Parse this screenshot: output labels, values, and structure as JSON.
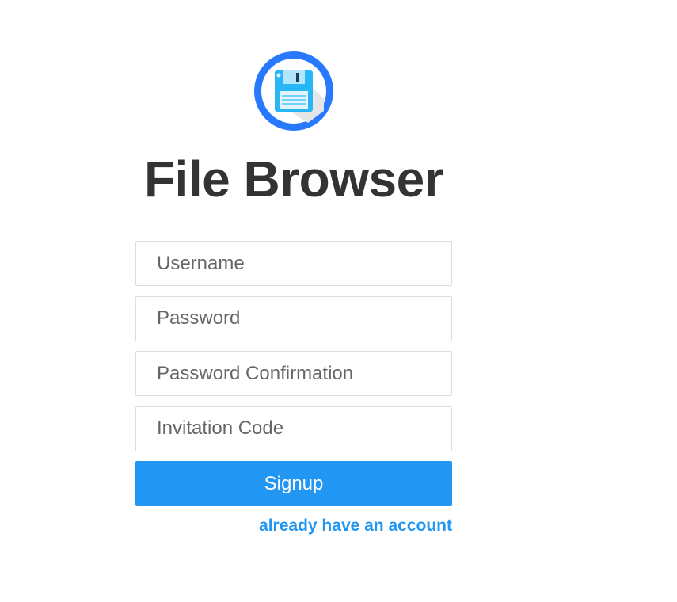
{
  "app": {
    "title": "File Browser",
    "logo_icon": "floppy-disk-icon"
  },
  "form": {
    "username_placeholder": "Username",
    "password_placeholder": "Password",
    "password_confirmation_placeholder": "Password Confirmation",
    "invitation_code_placeholder": "Invitation Code",
    "submit_label": "Signup",
    "login_link_label": "already have an account"
  },
  "colors": {
    "accent": "#2196f3",
    "logo_ring": "#2979ff",
    "title_text": "#333333"
  }
}
